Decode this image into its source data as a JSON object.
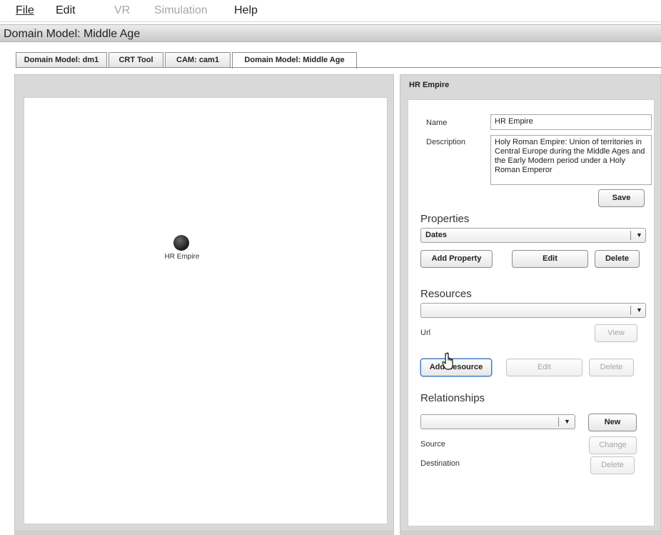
{
  "menu": {
    "file": "File",
    "edit": "Edit",
    "vr": "VR",
    "simulation": "Simulation",
    "help": "Help"
  },
  "window_title": "Domain Model: Middle Age",
  "tabs": [
    {
      "label": "Domain Model: dm1"
    },
    {
      "label": "CRT Tool"
    },
    {
      "label": "CAM: cam1"
    },
    {
      "label": "Domain Model: Middle Age",
      "active": true
    }
  ],
  "canvas": {
    "node_label": "HR Empire"
  },
  "detail": {
    "title": "HR Empire",
    "name_label": "Name",
    "name_value": "HR Empire",
    "description_label": "Description",
    "description_value": "Holy Roman Empire: Union of territories in Central Europe during the Middle Ages and the Early Modern period under a Holy Roman Emperor",
    "save_label": "Save"
  },
  "properties": {
    "heading": "Properties",
    "selected": "Dates",
    "add_label": "Add Property",
    "edit_label": "Edit",
    "delete_label": "Delete"
  },
  "resources": {
    "heading": "Resources",
    "selected": "",
    "url_label": "Url",
    "view_label": "View",
    "add_label": "Add Resource",
    "edit_label": "Edit",
    "delete_label": "Delete"
  },
  "relationships": {
    "heading": "Relationships",
    "selected": "",
    "new_label": "New",
    "source_label": "Source",
    "change_label": "Change",
    "destination_label": "Destination",
    "delete_label": "Delete"
  }
}
